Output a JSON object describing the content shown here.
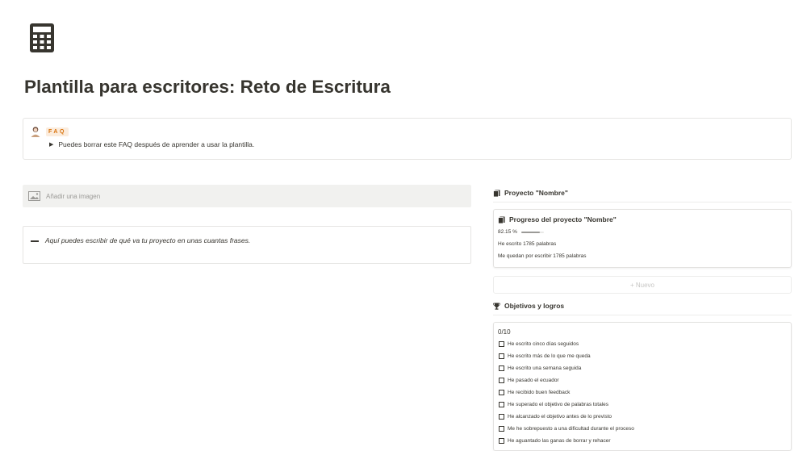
{
  "page": {
    "icon": "calculator-icon",
    "title": "Plantilla para escritores: Reto de Escritura"
  },
  "callout": {
    "avatar_icon": "avatar-icon",
    "tag": "FAQ",
    "toggle_text": "Puedes borrar este FAQ después de aprender a usar la plantilla."
  },
  "image_bar": {
    "icon": "image-icon",
    "label": "Añadir una imagen"
  },
  "description": {
    "text": "Aquí puedes escribir de qué va tu proyecto en unas cuantas frases."
  },
  "project": {
    "header": "Proyecto \"Nombre\"",
    "card_title": "Progreso del proyecto \"Nombre\"",
    "progress_label": "82.15 %",
    "progress_value": 0.8215,
    "written": "He escrito 1785 palabras",
    "remaining": "Me quedan por escribir 1785 palabras",
    "new_button": "+ Nuevo"
  },
  "goals": {
    "header": "Objetivos y logros",
    "count": "0/10",
    "items": [
      "He escrito cinco días seguidos",
      "He escrito más de lo que me queda",
      "He escrito una semana seguida",
      "He pasado el ecuador",
      "He recibido buen feedback",
      "He superado el objetivo de palabras totales",
      "He alcanzado el objetivo antes de lo previsto",
      "Me he sobrepuesto a una dificultad durante el proceso",
      "He aguantado las ganas de borrar y rehacer"
    ]
  }
}
